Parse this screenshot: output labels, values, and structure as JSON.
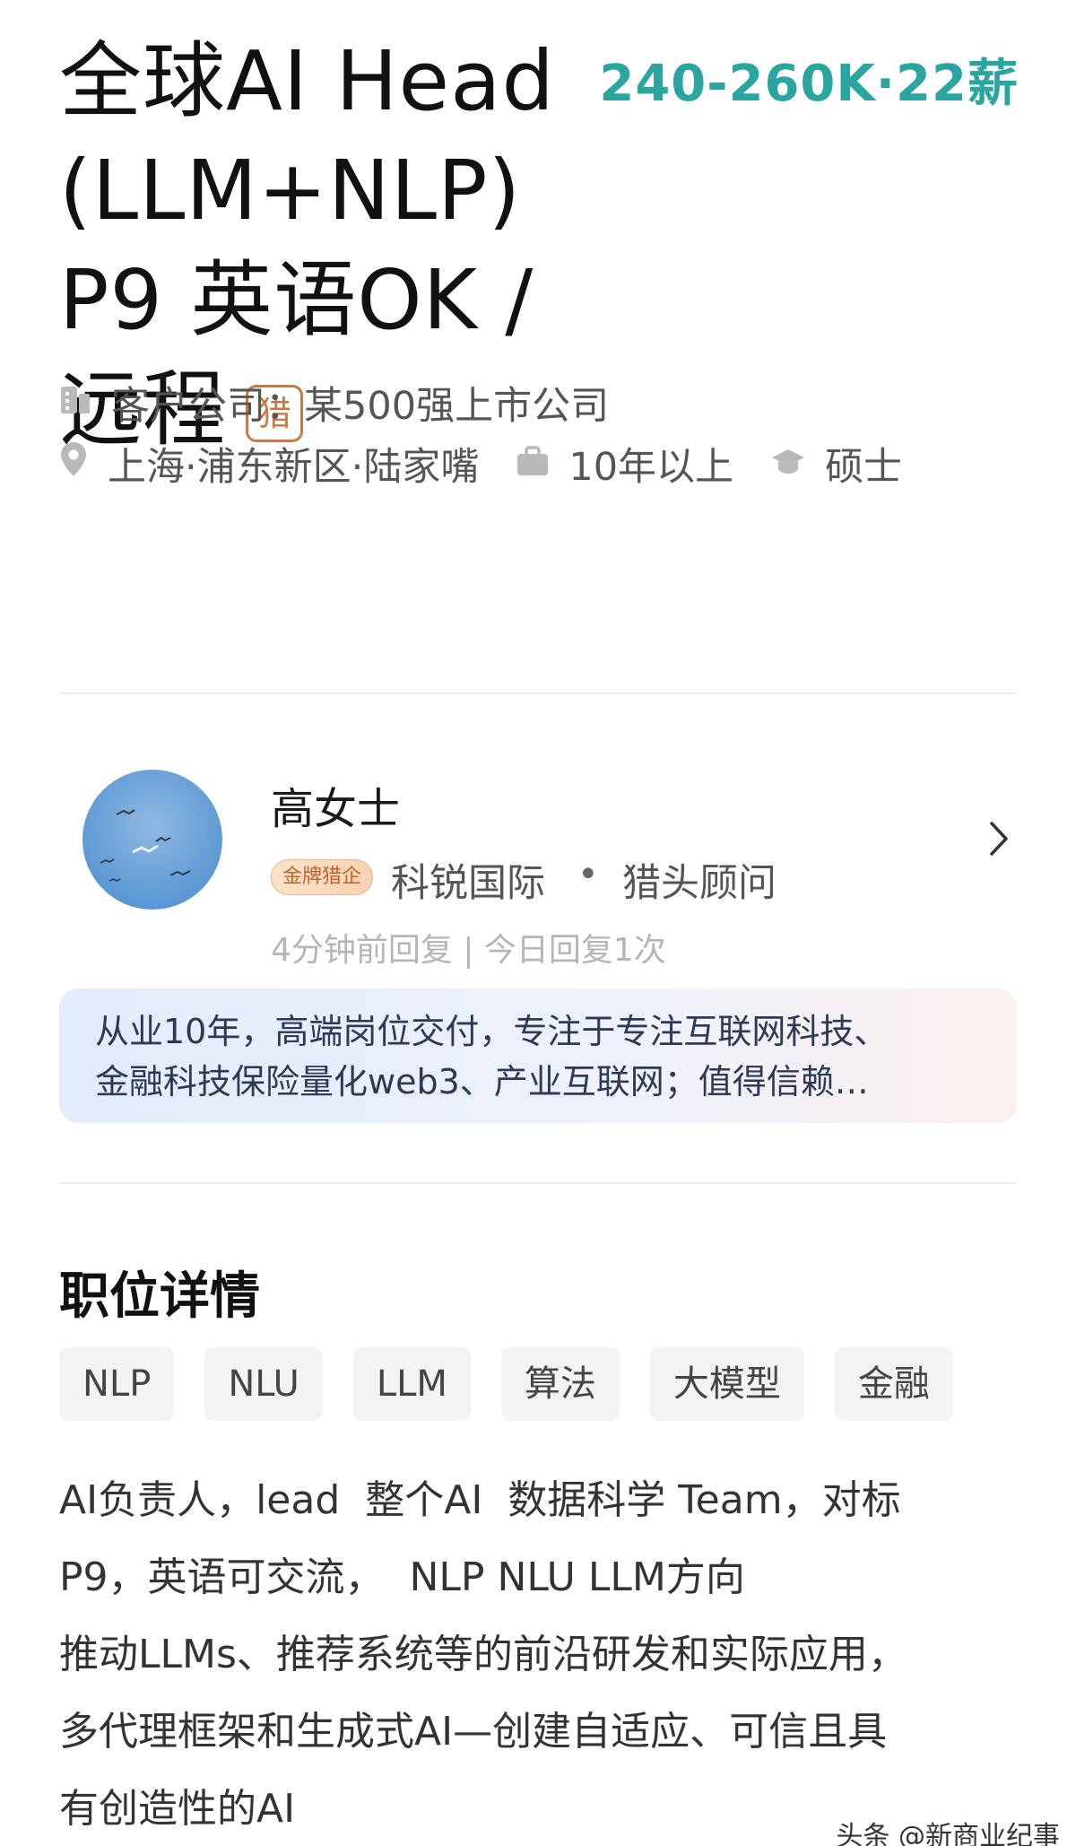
{
  "job": {
    "title_lines": [
      "全球AI Head",
      "(LLM+NLP)",
      "P9 英语OK /",
      "远程"
    ],
    "hunt_badge": "猎",
    "salary": "240-260K·22薪"
  },
  "meta": {
    "company": "客户公司：某500强上市公司",
    "location": "上海·浦东新区·陆家嘴",
    "experience": "10年以上",
    "education": "硕士"
  },
  "recruiter": {
    "name": "高女士",
    "badge": "金牌猎企",
    "company": "科锐国际",
    "dot": "•",
    "role": "猎头顾问",
    "reply": "4分钟前回复 | 今日回复1次",
    "intro_lines": [
      "从业10年，高端岗位交付，专注于专注互联网科技、",
      "金融科技保险量化web3、产业互联网；值得信赖…"
    ]
  },
  "details": {
    "section_title": "职位详情",
    "tags": [
      "NLP",
      "NLU",
      "LLM",
      "算法",
      "大模型",
      "金融"
    ],
    "description_lines": [
      "AI负责人，lead  整个AI  数据科学 Team，对标",
      "P9，英语可交流，  NLP NLU LLM方向",
      "推动LLMs、推荐系统等的前沿研发和实际应用，",
      "多代理框架和生成式AI—创建自适应、可信且具",
      "有创造性的AI"
    ]
  },
  "watermark": "头条 @新商业纪事",
  "colors": {
    "salary": "#2aa5a0",
    "hunt_badge": "#c67a45",
    "gold_badge_text": "#b8652c",
    "meta_text": "#555555",
    "reply_text": "#b5b5b5"
  },
  "icons": {
    "company": "building-icon",
    "location": "map-pin-icon",
    "experience": "briefcase-icon",
    "education": "graduation-cap-icon",
    "chevron": "chevron-right-icon"
  }
}
